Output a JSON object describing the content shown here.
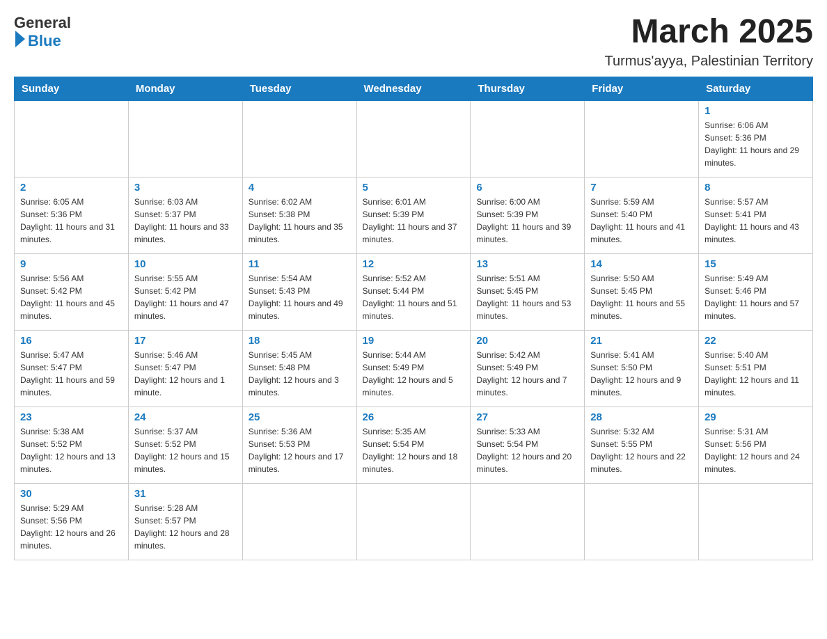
{
  "header": {
    "logo_general": "General",
    "logo_blue": "Blue",
    "month_title": "March 2025",
    "location": "Turmus'ayya, Palestinian Territory"
  },
  "weekdays": [
    "Sunday",
    "Monday",
    "Tuesday",
    "Wednesday",
    "Thursday",
    "Friday",
    "Saturday"
  ],
  "weeks": [
    [
      {
        "day": "",
        "sunrise": "",
        "sunset": "",
        "daylight": ""
      },
      {
        "day": "",
        "sunrise": "",
        "sunset": "",
        "daylight": ""
      },
      {
        "day": "",
        "sunrise": "",
        "sunset": "",
        "daylight": ""
      },
      {
        "day": "",
        "sunrise": "",
        "sunset": "",
        "daylight": ""
      },
      {
        "day": "",
        "sunrise": "",
        "sunset": "",
        "daylight": ""
      },
      {
        "day": "",
        "sunrise": "",
        "sunset": "",
        "daylight": ""
      },
      {
        "day": "1",
        "sunrise": "Sunrise: 6:06 AM",
        "sunset": "Sunset: 5:36 PM",
        "daylight": "Daylight: 11 hours and 29 minutes."
      }
    ],
    [
      {
        "day": "2",
        "sunrise": "Sunrise: 6:05 AM",
        "sunset": "Sunset: 5:36 PM",
        "daylight": "Daylight: 11 hours and 31 minutes."
      },
      {
        "day": "3",
        "sunrise": "Sunrise: 6:03 AM",
        "sunset": "Sunset: 5:37 PM",
        "daylight": "Daylight: 11 hours and 33 minutes."
      },
      {
        "day": "4",
        "sunrise": "Sunrise: 6:02 AM",
        "sunset": "Sunset: 5:38 PM",
        "daylight": "Daylight: 11 hours and 35 minutes."
      },
      {
        "day": "5",
        "sunrise": "Sunrise: 6:01 AM",
        "sunset": "Sunset: 5:39 PM",
        "daylight": "Daylight: 11 hours and 37 minutes."
      },
      {
        "day": "6",
        "sunrise": "Sunrise: 6:00 AM",
        "sunset": "Sunset: 5:39 PM",
        "daylight": "Daylight: 11 hours and 39 minutes."
      },
      {
        "day": "7",
        "sunrise": "Sunrise: 5:59 AM",
        "sunset": "Sunset: 5:40 PM",
        "daylight": "Daylight: 11 hours and 41 minutes."
      },
      {
        "day": "8",
        "sunrise": "Sunrise: 5:57 AM",
        "sunset": "Sunset: 5:41 PM",
        "daylight": "Daylight: 11 hours and 43 minutes."
      }
    ],
    [
      {
        "day": "9",
        "sunrise": "Sunrise: 5:56 AM",
        "sunset": "Sunset: 5:42 PM",
        "daylight": "Daylight: 11 hours and 45 minutes."
      },
      {
        "day": "10",
        "sunrise": "Sunrise: 5:55 AM",
        "sunset": "Sunset: 5:42 PM",
        "daylight": "Daylight: 11 hours and 47 minutes."
      },
      {
        "day": "11",
        "sunrise": "Sunrise: 5:54 AM",
        "sunset": "Sunset: 5:43 PM",
        "daylight": "Daylight: 11 hours and 49 minutes."
      },
      {
        "day": "12",
        "sunrise": "Sunrise: 5:52 AM",
        "sunset": "Sunset: 5:44 PM",
        "daylight": "Daylight: 11 hours and 51 minutes."
      },
      {
        "day": "13",
        "sunrise": "Sunrise: 5:51 AM",
        "sunset": "Sunset: 5:45 PM",
        "daylight": "Daylight: 11 hours and 53 minutes."
      },
      {
        "day": "14",
        "sunrise": "Sunrise: 5:50 AM",
        "sunset": "Sunset: 5:45 PM",
        "daylight": "Daylight: 11 hours and 55 minutes."
      },
      {
        "day": "15",
        "sunrise": "Sunrise: 5:49 AM",
        "sunset": "Sunset: 5:46 PM",
        "daylight": "Daylight: 11 hours and 57 minutes."
      }
    ],
    [
      {
        "day": "16",
        "sunrise": "Sunrise: 5:47 AM",
        "sunset": "Sunset: 5:47 PM",
        "daylight": "Daylight: 11 hours and 59 minutes."
      },
      {
        "day": "17",
        "sunrise": "Sunrise: 5:46 AM",
        "sunset": "Sunset: 5:47 PM",
        "daylight": "Daylight: 12 hours and 1 minute."
      },
      {
        "day": "18",
        "sunrise": "Sunrise: 5:45 AM",
        "sunset": "Sunset: 5:48 PM",
        "daylight": "Daylight: 12 hours and 3 minutes."
      },
      {
        "day": "19",
        "sunrise": "Sunrise: 5:44 AM",
        "sunset": "Sunset: 5:49 PM",
        "daylight": "Daylight: 12 hours and 5 minutes."
      },
      {
        "day": "20",
        "sunrise": "Sunrise: 5:42 AM",
        "sunset": "Sunset: 5:49 PM",
        "daylight": "Daylight: 12 hours and 7 minutes."
      },
      {
        "day": "21",
        "sunrise": "Sunrise: 5:41 AM",
        "sunset": "Sunset: 5:50 PM",
        "daylight": "Daylight: 12 hours and 9 minutes."
      },
      {
        "day": "22",
        "sunrise": "Sunrise: 5:40 AM",
        "sunset": "Sunset: 5:51 PM",
        "daylight": "Daylight: 12 hours and 11 minutes."
      }
    ],
    [
      {
        "day": "23",
        "sunrise": "Sunrise: 5:38 AM",
        "sunset": "Sunset: 5:52 PM",
        "daylight": "Daylight: 12 hours and 13 minutes."
      },
      {
        "day": "24",
        "sunrise": "Sunrise: 5:37 AM",
        "sunset": "Sunset: 5:52 PM",
        "daylight": "Daylight: 12 hours and 15 minutes."
      },
      {
        "day": "25",
        "sunrise": "Sunrise: 5:36 AM",
        "sunset": "Sunset: 5:53 PM",
        "daylight": "Daylight: 12 hours and 17 minutes."
      },
      {
        "day": "26",
        "sunrise": "Sunrise: 5:35 AM",
        "sunset": "Sunset: 5:54 PM",
        "daylight": "Daylight: 12 hours and 18 minutes."
      },
      {
        "day": "27",
        "sunrise": "Sunrise: 5:33 AM",
        "sunset": "Sunset: 5:54 PM",
        "daylight": "Daylight: 12 hours and 20 minutes."
      },
      {
        "day": "28",
        "sunrise": "Sunrise: 5:32 AM",
        "sunset": "Sunset: 5:55 PM",
        "daylight": "Daylight: 12 hours and 22 minutes."
      },
      {
        "day": "29",
        "sunrise": "Sunrise: 5:31 AM",
        "sunset": "Sunset: 5:56 PM",
        "daylight": "Daylight: 12 hours and 24 minutes."
      }
    ],
    [
      {
        "day": "30",
        "sunrise": "Sunrise: 5:29 AM",
        "sunset": "Sunset: 5:56 PM",
        "daylight": "Daylight: 12 hours and 26 minutes."
      },
      {
        "day": "31",
        "sunrise": "Sunrise: 5:28 AM",
        "sunset": "Sunset: 5:57 PM",
        "daylight": "Daylight: 12 hours and 28 minutes."
      },
      {
        "day": "",
        "sunrise": "",
        "sunset": "",
        "daylight": ""
      },
      {
        "day": "",
        "sunrise": "",
        "sunset": "",
        "daylight": ""
      },
      {
        "day": "",
        "sunrise": "",
        "sunset": "",
        "daylight": ""
      },
      {
        "day": "",
        "sunrise": "",
        "sunset": "",
        "daylight": ""
      },
      {
        "day": "",
        "sunrise": "",
        "sunset": "",
        "daylight": ""
      }
    ]
  ]
}
